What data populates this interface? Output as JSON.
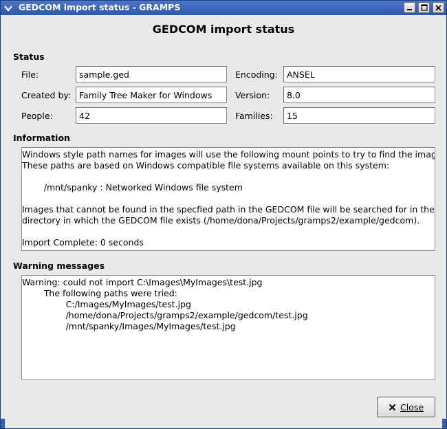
{
  "window": {
    "title": "GEDCOM import status - GRAMPS"
  },
  "dialog": {
    "heading": "GEDCOM import status"
  },
  "status": {
    "section_label": "Status",
    "file_label": "File:",
    "file_value": "sample.ged",
    "encoding_label": "Encoding:",
    "encoding_value": "ANSEL",
    "created_by_label": "Created by:",
    "created_by_value": "Family Tree Maker for Windows",
    "version_label": "Version:",
    "version_value": "8.0",
    "people_label": "People:",
    "people_value": "42",
    "families_label": "Families:",
    "families_value": "15"
  },
  "information": {
    "section_label": "Information",
    "lines": [
      "Windows style path names for images will use the following mount points to try to find the images.",
      "These paths are based on Windows compatible file systems available on this system:",
      "",
      "        /mnt/spanky : Networked Windows file system",
      "",
      "Images that cannot be found in the specfied path in the GEDCOM file will be searched for in the same",
      "directory in which the GEDCOM file exists (/home/dona/Projects/gramps2/example/gedcom).",
      "",
      "Import Complete: 0 seconds"
    ]
  },
  "warnings": {
    "section_label": "Warning messages",
    "lines": [
      "Warning: could not import C:\\Images\\MyImages\\test.jpg",
      "        The following paths were tried:",
      "                C:/Images/MyImages/test.jpg",
      "                /home/dona/Projects/gramps2/example/gedcom/test.jpg",
      "                /mnt/spanky/Images/MyImages/test.jpg"
    ]
  },
  "buttons": {
    "close_label": "Close"
  },
  "icons": {
    "window_menu": "chevron-down-icon",
    "minimize": "minimize-icon",
    "maximize": "maximize-icon",
    "close": "close-icon",
    "close_button": "x-icon"
  }
}
